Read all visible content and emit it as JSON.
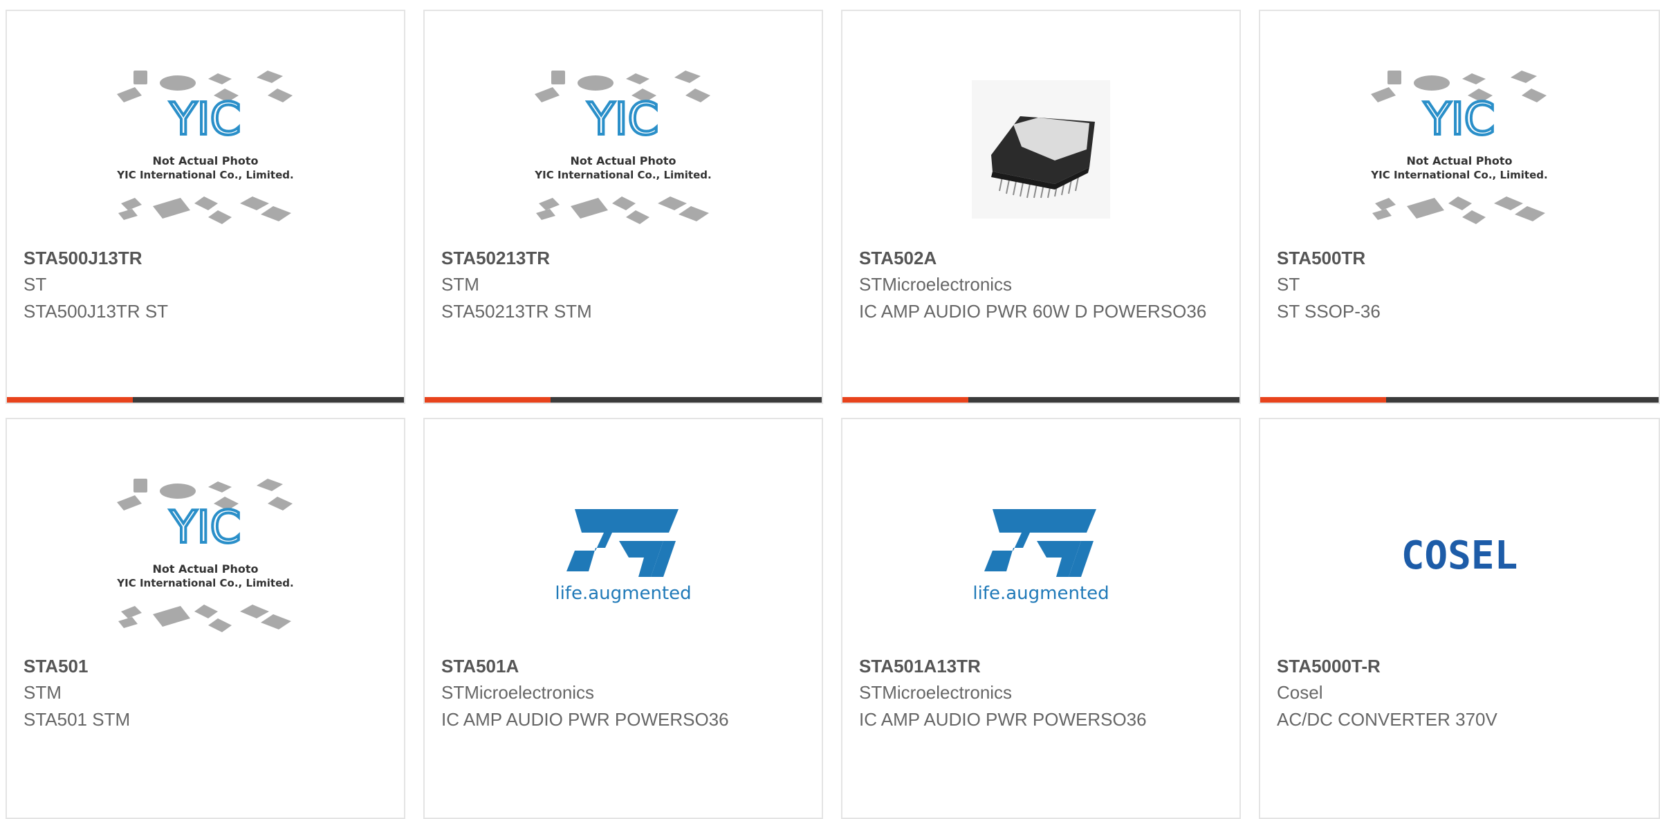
{
  "placeholder": {
    "line1": "Not Actual Photo",
    "line2": "YIC International Co., Limited.",
    "logo_text": "YIC"
  },
  "st_logo": {
    "text": "life.augmented"
  },
  "cosel_logo": {
    "text": "COSEL"
  },
  "products": [
    {
      "part_number": "STA500J13TR",
      "manufacturer": "ST",
      "description": "STA500J13TR ST",
      "image": "placeholder-photo"
    },
    {
      "part_number": "STA50213TR",
      "manufacturer": "STM",
      "description": "STA50213TR STM",
      "image": "placeholder-photo"
    },
    {
      "part_number": "STA502A",
      "manufacturer": "STMicroelectronics",
      "description": "IC AMP AUDIO PWR 60W D POWERSO36",
      "image": "chip-photo"
    },
    {
      "part_number": "STA500TR",
      "manufacturer": "ST",
      "description": "ST SSOP-36",
      "image": "placeholder-photo"
    },
    {
      "part_number": "STA501",
      "manufacturer": "STM",
      "description": "STA501 STM",
      "image": "placeholder-photo"
    },
    {
      "part_number": "STA501A",
      "manufacturer": "STMicroelectronics",
      "description": "IC AMP AUDIO PWR POWERSO36",
      "image": "st-logo"
    },
    {
      "part_number": "STA501A13TR",
      "manufacturer": "STMicroelectronics",
      "description": "IC AMP AUDIO PWR POWERSO36",
      "image": "st-logo"
    },
    {
      "part_number": "STA5000T-R",
      "manufacturer": "Cosel",
      "description": "AC/DC CONVERTER 370V",
      "image": "cosel-logo"
    }
  ],
  "colors": {
    "accent": "#e8431c",
    "bar": "#3b3b3b",
    "yic_blue": "#2a8fc9",
    "st_blue": "#1f79b8",
    "cosel_blue": "#1d5ca8"
  }
}
